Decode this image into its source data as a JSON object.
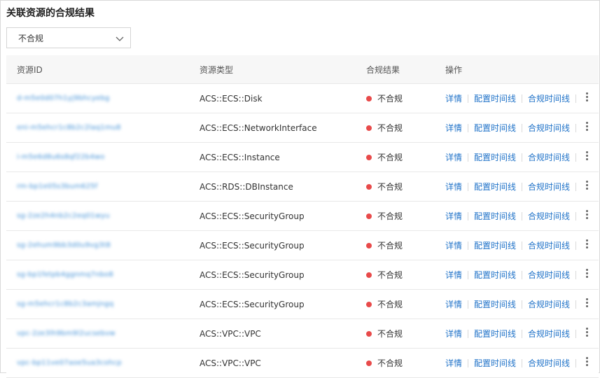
{
  "section": {
    "title": "关联资源的合规结果"
  },
  "filter": {
    "selected": "不合规"
  },
  "table": {
    "headers": {
      "id": "资源ID",
      "type": "资源类型",
      "result": "合规结果",
      "ops": "操作"
    },
    "rows": [
      {
        "id": "d-m5e0d07h1yj9bhcyebg",
        "type": "ACS::ECS::Disk",
        "result": "不合规"
      },
      {
        "id": "eni-m5ehcr1c8b2c2laq1mu8",
        "type": "ACS::ECS::NetworkInterface",
        "result": "不合规"
      },
      {
        "id": "i-m5e6d8u6s8qf22b4wo",
        "type": "ACS::ECS::Instance",
        "result": "不合规"
      },
      {
        "id": "rm-bp1e05s3bum625f",
        "type": "ACS::RDS::DBInstance",
        "result": "不合规"
      },
      {
        "id": "sg-2ze2h4nb2c2eq01wyu",
        "type": "ACS::ECS::SecurityGroup",
        "result": "不合规"
      },
      {
        "id": "sg-2ehum9bb3d0u9vg3t8",
        "type": "ACS::ECS::SecurityGroup",
        "result": "不合规"
      },
      {
        "id": "sg-bp1fetpb4ggnmq7nbo8",
        "type": "ACS::ECS::SecurityGroup",
        "result": "不合规"
      },
      {
        "id": "sg-m5ehcr1c8b2c3amjngq",
        "type": "ACS::ECS::SecurityGroup",
        "result": "不合规"
      },
      {
        "id": "vpc-2ze3lh9bm9l2ucsebvw",
        "type": "ACS::VPC::VPC",
        "result": "不合规"
      },
      {
        "id": "vpc-bp11ve07aoe5ua3cohcp",
        "type": "ACS::VPC::VPC",
        "result": "不合规"
      }
    ],
    "actions": {
      "detail": "详情",
      "config_timeline": "配置时间线",
      "compliance_timeline": "合规时间线"
    }
  },
  "colors": {
    "status_noncompliant": "#e84a4a",
    "link": "#1f72c8",
    "header_bg": "#f7f7f7"
  },
  "icons": {
    "dropdown": "chevron-down-icon",
    "more": "more-vertical-icon"
  }
}
